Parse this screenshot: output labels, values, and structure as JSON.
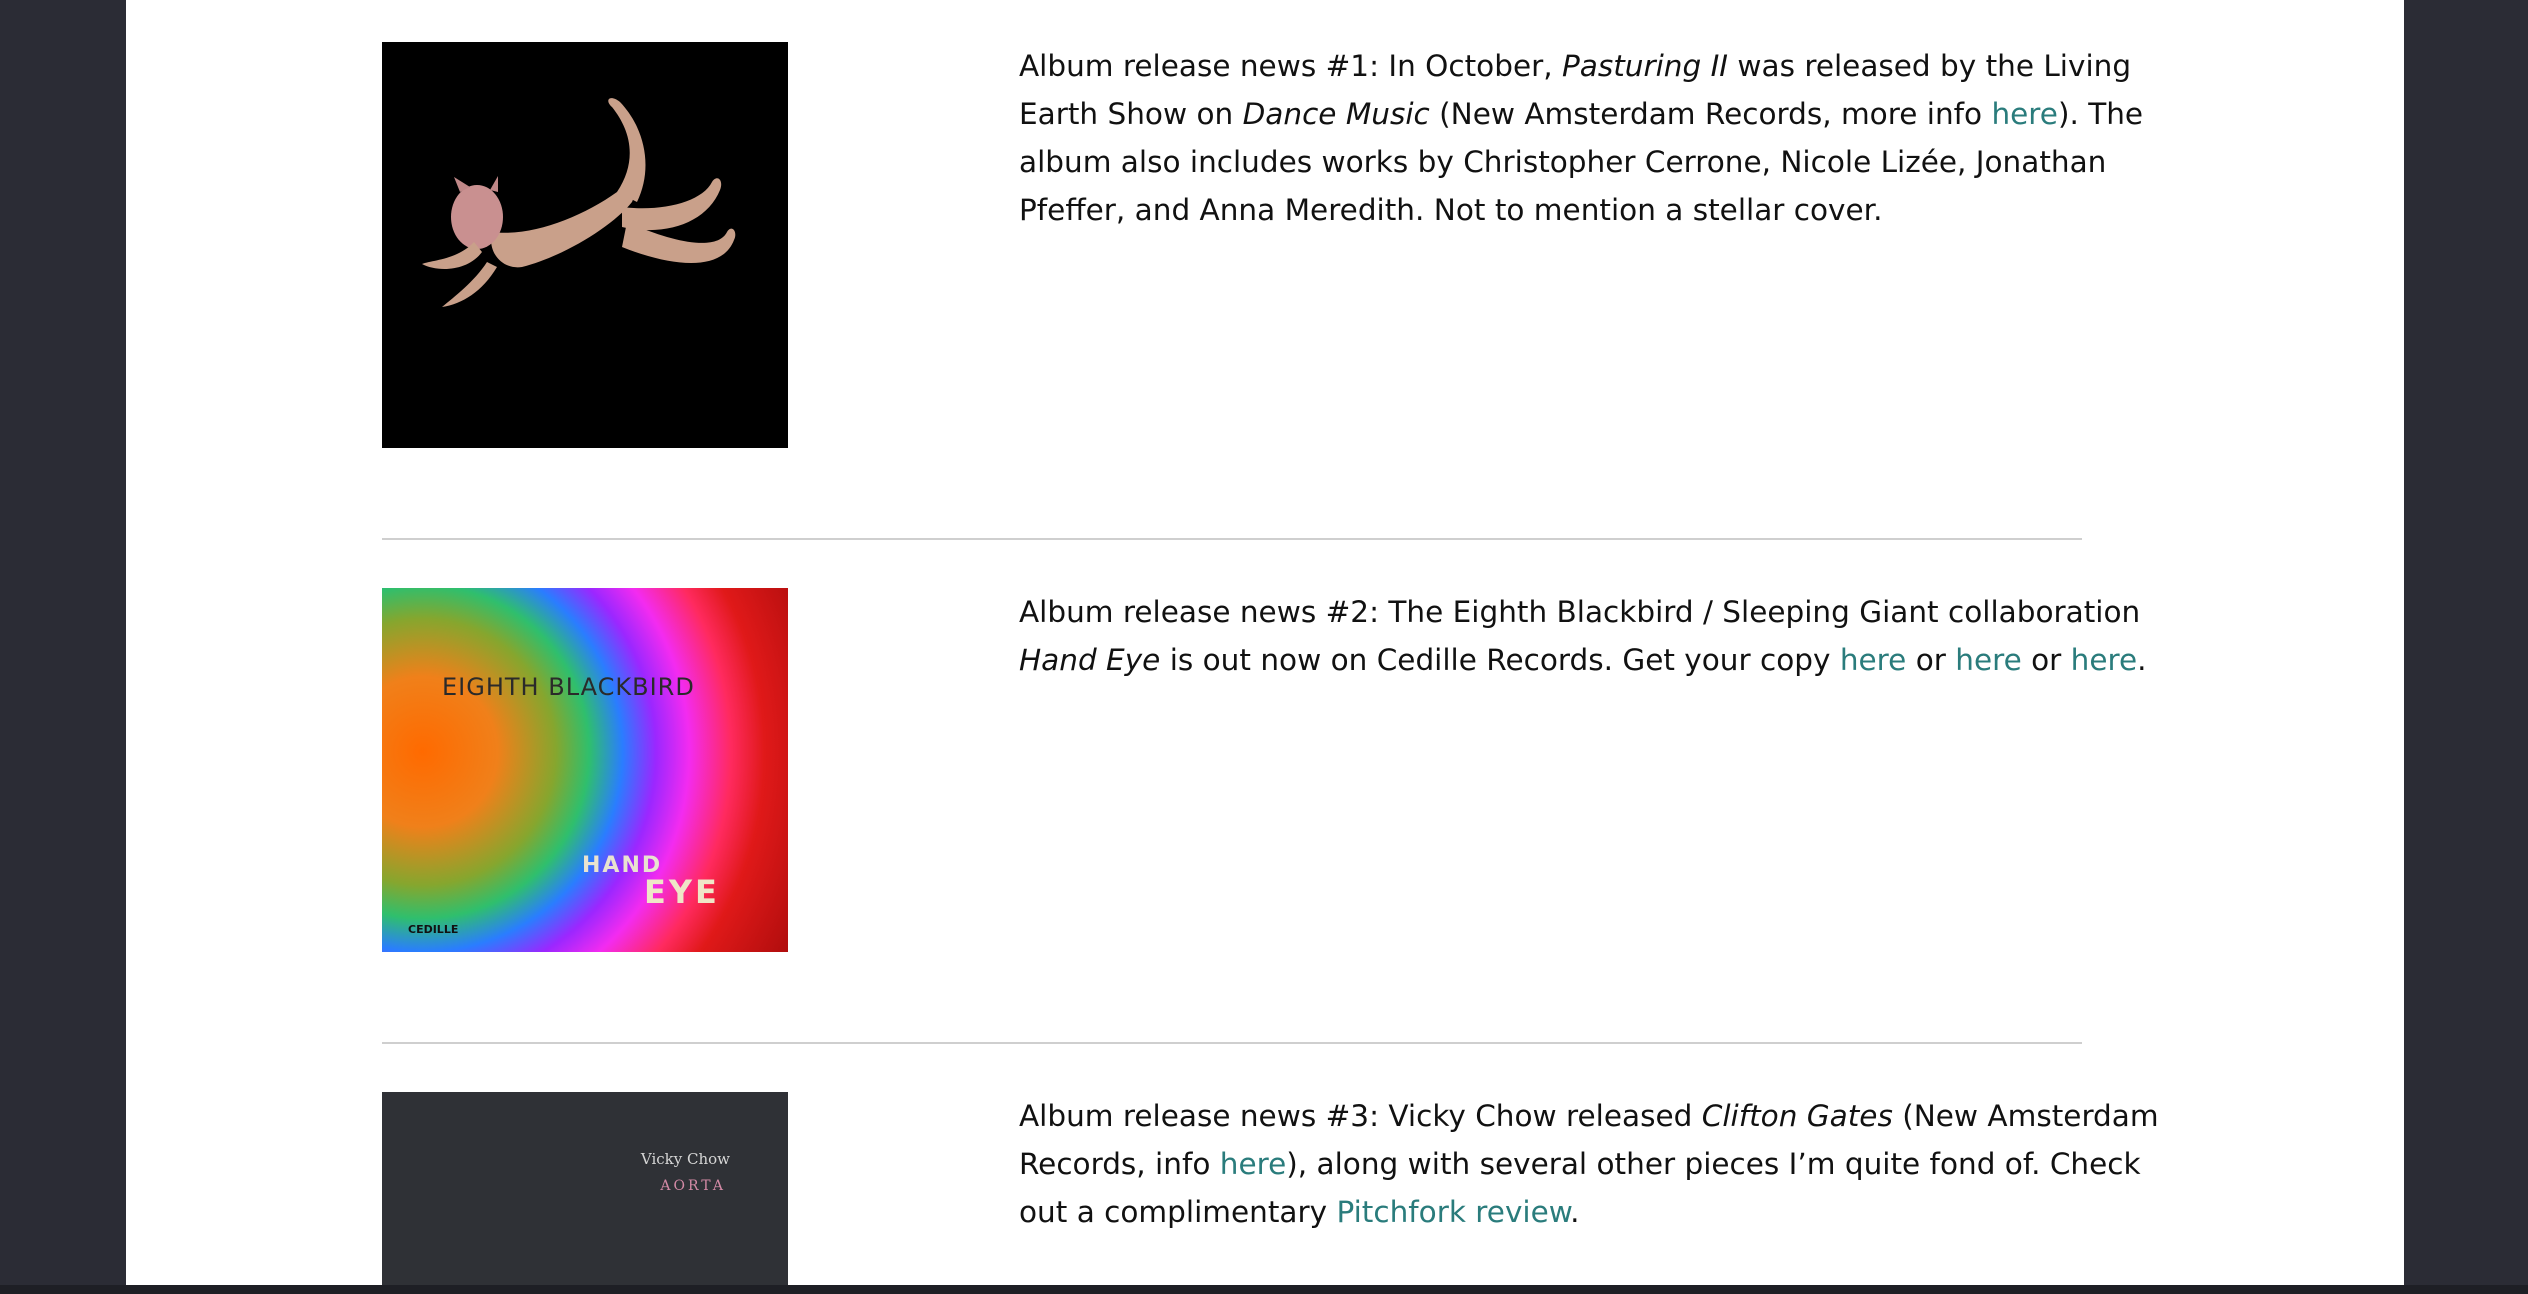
{
  "colors": {
    "background": "#2b2c35",
    "page": "#ffffff",
    "link": "#2a7c7c",
    "text": "#111111",
    "divider": "#cfcfcf"
  },
  "posts": [
    {
      "cover_icon": "album-cover-dancer-image",
      "text": {
        "p1": "Album release news #1: In October, ",
        "album": "Pasturing II",
        "p2": " was released by the Living Earth Show on ",
        "album2": "Dance Music",
        "p3": " (New Amsterdam Records, more info ",
        "link1": "here",
        "p4": "). The album also includes works by Christopher Cerrone, Nicole Lizée, Jonathan Pfeffer, and Anna Meredith. Not to mention a stellar cover."
      }
    },
    {
      "cover_icon": "album-cover-hand-eye-image",
      "cover_band": "EIGHTH BLACKBIRD",
      "cover_hand": "HAND",
      "cover_eye": "EYE",
      "cover_label": "CEDILLE",
      "text": {
        "p1": "Album release news #2: The Eighth Blackbird / Sleeping Giant collaboration ",
        "album": "Hand Eye",
        "p2": " is out now on Cedille Records. Get your copy ",
        "link1": "here",
        "p3": " or ",
        "link2": "here",
        "p4": " or ",
        "link3": "here",
        "p5": "."
      }
    },
    {
      "cover_icon": "album-cover-aorta-image",
      "cover_artist": "Vicky Chow",
      "cover_album": "AORTA",
      "text": {
        "p1": "Album release news #3: Vicky Chow released ",
        "album": "Clifton Gates",
        "p2": " (New Amsterdam Records, info ",
        "link1": "here",
        "p3": "), along with several other pieces I’m quite fond of. Check out a complimentary ",
        "link2": "Pitchfork review",
        "p4": "."
      }
    }
  ]
}
